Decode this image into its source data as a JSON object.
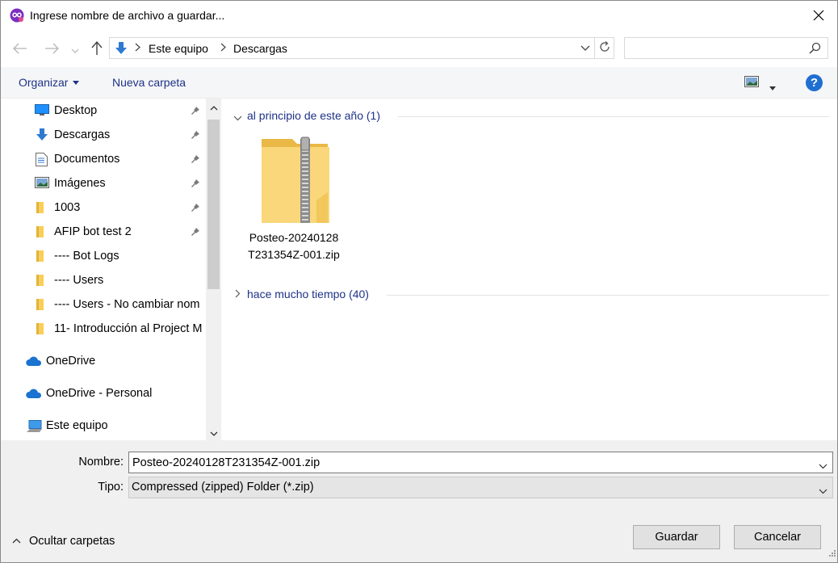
{
  "window": {
    "title": "Ingrese nombre de archivo a guardar...",
    "app_icon": "app-logo-icon",
    "close_icon": "close-icon"
  },
  "address": {
    "crumbs": [
      "Este equipo",
      "Descargas"
    ],
    "search_placeholder": ""
  },
  "toolbar": {
    "organize_label": "Organizar",
    "new_folder_label": "Nueva carpeta",
    "help_label": "?"
  },
  "sidebar": {
    "items": [
      {
        "label": "Desktop",
        "icon": "desktop-icon",
        "pinned": true
      },
      {
        "label": "Descargas",
        "icon": "download-arrow-icon",
        "pinned": true
      },
      {
        "label": "Documentos",
        "icon": "document-icon",
        "pinned": true
      },
      {
        "label": "Imágenes",
        "icon": "pictures-icon",
        "pinned": true
      },
      {
        "label": "1003",
        "icon": "folder-icon",
        "pinned": true
      },
      {
        "label": "AFIP bot test 2",
        "icon": "folder-icon",
        "pinned": true
      },
      {
        "label": "---- Bot Logs",
        "icon": "folder-icon",
        "pinned": false
      },
      {
        "label": "---- Users",
        "icon": "folder-icon",
        "pinned": false
      },
      {
        "label": "---- Users - No cambiar nom",
        "icon": "folder-icon",
        "pinned": false
      },
      {
        "label": "11- Introducción al Project M",
        "icon": "folder-icon",
        "pinned": false
      },
      {
        "label": "OneDrive",
        "icon": "cloud-icon",
        "pinned": false
      },
      {
        "label": "OneDrive - Personal",
        "icon": "cloud-icon",
        "pinned": false
      },
      {
        "label": "Este equipo",
        "icon": "computer-icon",
        "pinned": false
      }
    ]
  },
  "content": {
    "groups": [
      {
        "label": "al principio de este año (1)",
        "expanded": true
      },
      {
        "label": "hace mucho tiempo (40)",
        "expanded": false
      }
    ],
    "file": {
      "name": "Posteo-20240128T231354Z-001.zip",
      "icon": "zip-folder-icon"
    }
  },
  "form": {
    "name_label": "Nombre:",
    "name_value": "Posteo-20240128T231354Z-001.zip",
    "type_label": "Tipo:",
    "type_value": "Compressed (zipped) Folder (*.zip)"
  },
  "footer": {
    "hide_folders_label": "Ocultar carpetas",
    "save_label": "Guardar",
    "cancel_label": "Cancelar"
  },
  "colors": {
    "link_blue": "#1e3287",
    "folder_yellow": "#f7cf5a",
    "help_blue": "#1f6fd1",
    "panel_gray": "#f0f0f0"
  }
}
